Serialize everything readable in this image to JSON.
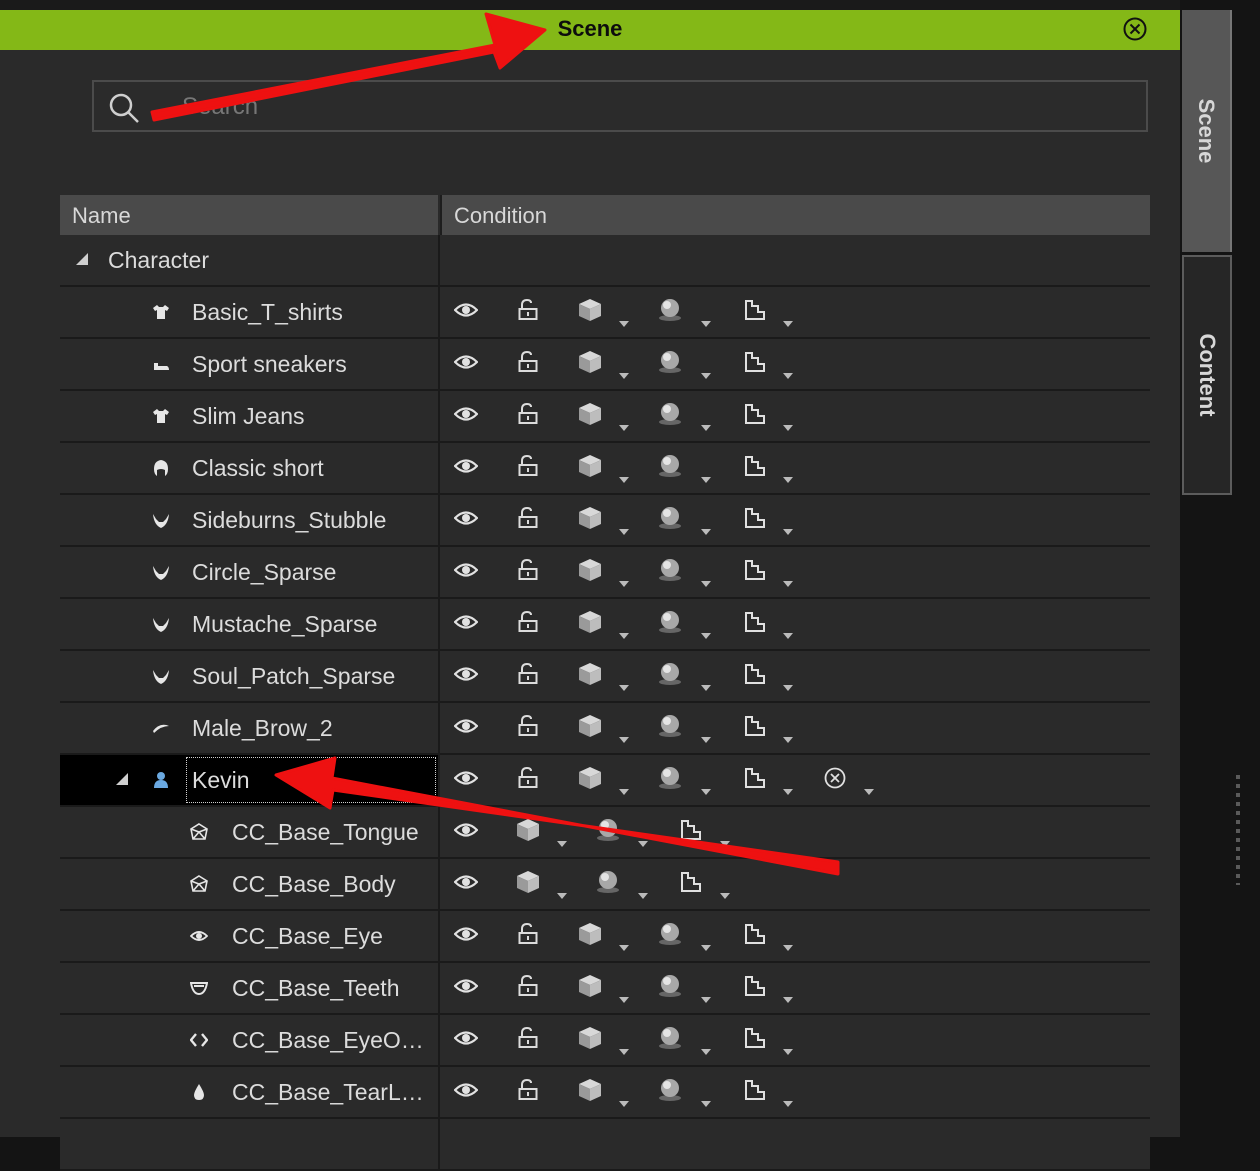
{
  "panel": {
    "title": "Scene",
    "accent_color": "#84b817"
  },
  "search": {
    "placeholder": "Search"
  },
  "columns": {
    "name": "Name",
    "condition": "Condition"
  },
  "side_tabs": [
    {
      "label": "Scene"
    },
    {
      "label": "Content"
    }
  ],
  "tree": {
    "group": {
      "label": "Character",
      "expanded": true
    },
    "rows": [
      {
        "label": "Basic_T_shirts",
        "icon": "shirt-icon"
      },
      {
        "label": "Sport sneakers",
        "icon": "shoe-icon"
      },
      {
        "label": "Slim Jeans",
        "icon": "shirt-icon"
      },
      {
        "label": "Classic short",
        "icon": "hair-icon"
      },
      {
        "label": "Sideburns_Stubble",
        "icon": "beard-icon"
      },
      {
        "label": "Circle_Sparse",
        "icon": "beard-icon"
      },
      {
        "label": "Mustache_Sparse",
        "icon": "beard-icon"
      },
      {
        "label": "Soul_Patch_Sparse",
        "icon": "beard-icon"
      },
      {
        "label": "Male_Brow_2",
        "icon": "brow-icon"
      },
      {
        "label": "Kevin",
        "icon": "person-icon",
        "selected": true,
        "expanded": true
      },
      {
        "label": "CC_Base_Tongue",
        "icon": "mesh-icon"
      },
      {
        "label": "CC_Base_Body",
        "icon": "mesh-icon"
      },
      {
        "label": "CC_Base_Eye",
        "icon": "eye-small-icon"
      },
      {
        "label": "CC_Base_Teeth",
        "icon": "teeth-icon"
      },
      {
        "label": "CC_Base_EyeO…",
        "icon": "brackets-icon"
      },
      {
        "label": "CC_Base_TearL…",
        "icon": "drop-icon"
      }
    ]
  },
  "condition_icons": [
    "visibility-eye-icon",
    "unlock-icon",
    "cube-icon",
    "sphere-material-icon",
    "pose-step-icon",
    "remove-circle-icon"
  ],
  "annotation": {
    "arrow_color": "#ee1111"
  }
}
